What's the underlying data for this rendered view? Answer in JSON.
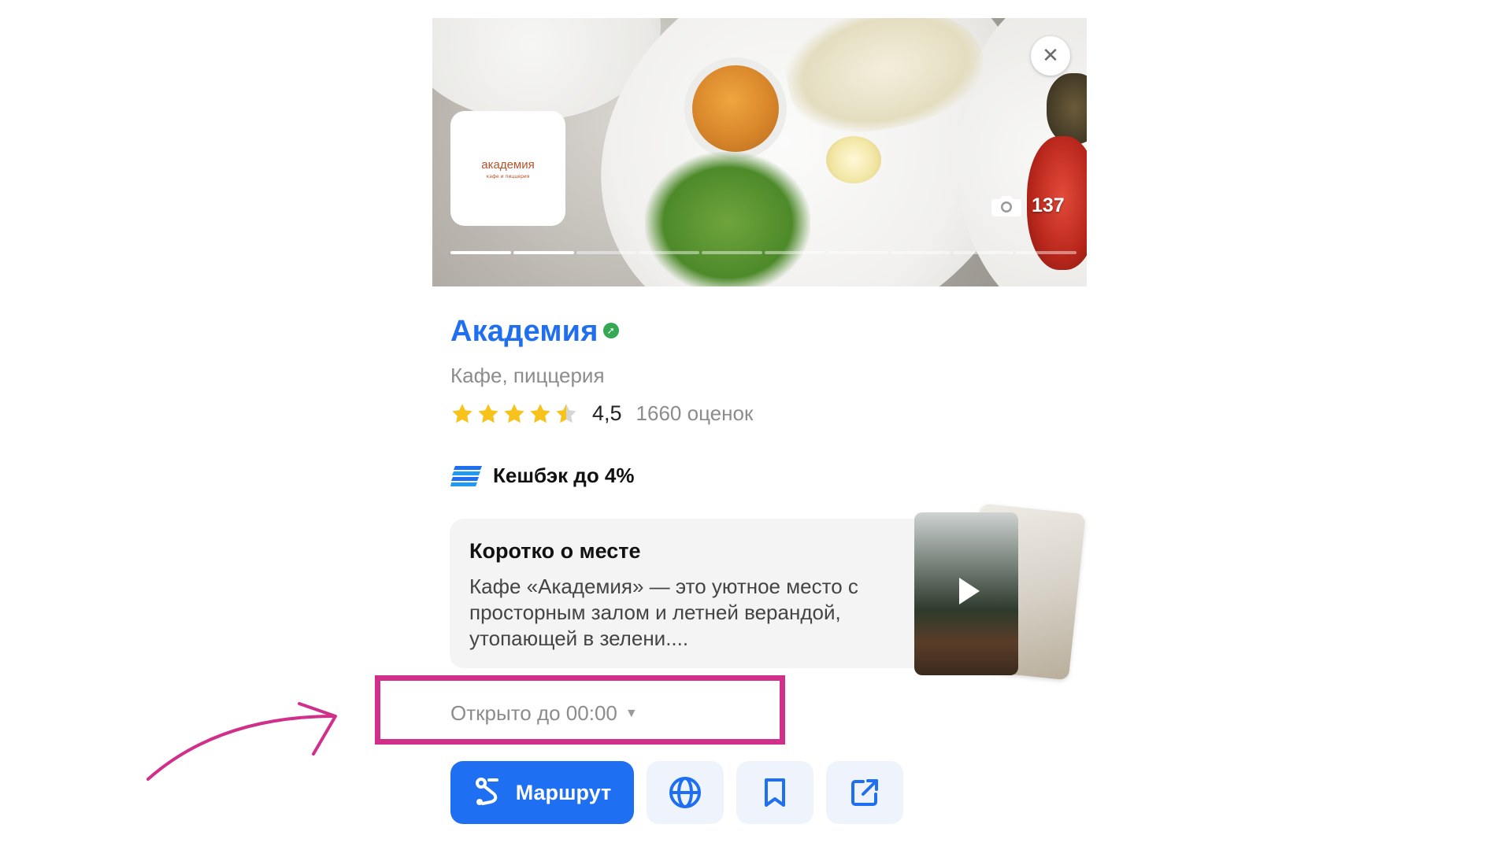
{
  "photo": {
    "logo_main": "академия",
    "logo_sub": "кафе и пиццерия",
    "count": "137",
    "slides_total": 10,
    "slide_active": 2
  },
  "place": {
    "name": "Академия",
    "category": "Кафе, пиццерия",
    "rating": "4,5",
    "rating_stars": 4.5,
    "reviews": "1660 оценок",
    "cashback": "Кешбэк до 4%"
  },
  "about": {
    "title": "Коротко о месте",
    "text": "Кафе «Академия» — это уютное место с просторным залом и летней верандой, утопающей в зелени...."
  },
  "hours": {
    "text": "Открыто до 00:00"
  },
  "actions": {
    "route_label": "Маршрут"
  },
  "colors": {
    "accent": "#1e6ff1",
    "highlight": "#d1308a",
    "star": "#f7c21a"
  }
}
